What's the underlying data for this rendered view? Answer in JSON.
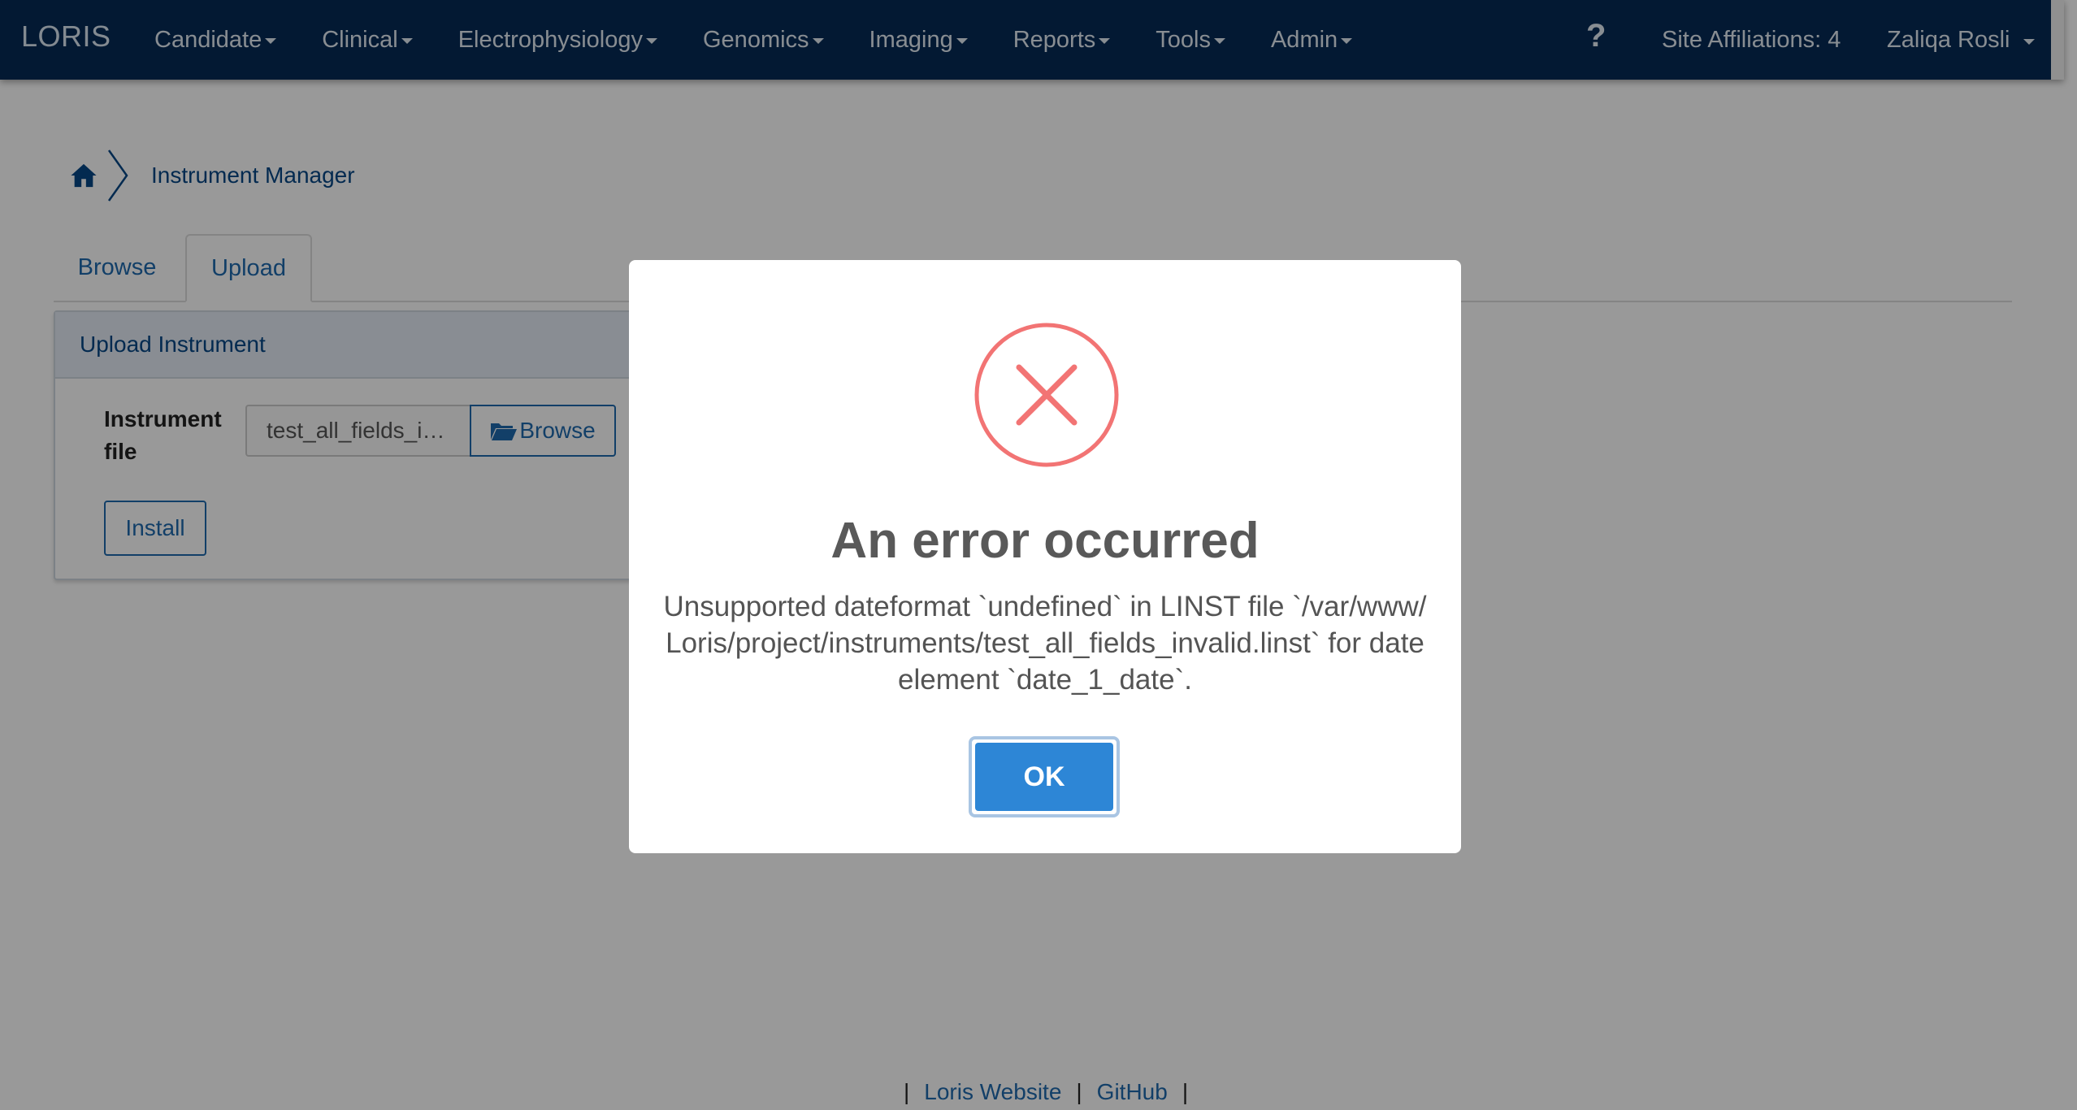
{
  "navbar": {
    "brand": "LORIS",
    "menus": [
      "Candidate",
      "Clinical",
      "Electrophysiology",
      "Genomics",
      "Imaging",
      "Reports",
      "Tools",
      "Admin"
    ],
    "help_label": "?",
    "site_affiliations": "Site Affiliations: 4",
    "user_name": "Zaliqa Rosli",
    "background_color": "#052a55"
  },
  "breadcrumb": {
    "home_icon": "home-icon",
    "label": "Instrument Manager"
  },
  "tabs": {
    "browse": "Browse",
    "upload": "Upload",
    "active": "Upload"
  },
  "panel": {
    "heading": "Upload Instrument",
    "field_label": "Instrument file",
    "file_name": "test_all_fields_i…",
    "browse_label": "Browse",
    "install_label": "Install"
  },
  "footer": {
    "links": [
      "Loris Website",
      "GitHub"
    ],
    "separator": "|"
  },
  "modal": {
    "icon": "error-x-icon",
    "icon_color": "#f27474",
    "title": "An error occurred",
    "message": "Unsupported dateformat `undefined` in LINST file `/var/www/Loris/project/instruments/test_all_fields_invalid.linst` for date element `date_1_date`.",
    "ok_label": "OK",
    "ok_color": "#2d86d6"
  }
}
